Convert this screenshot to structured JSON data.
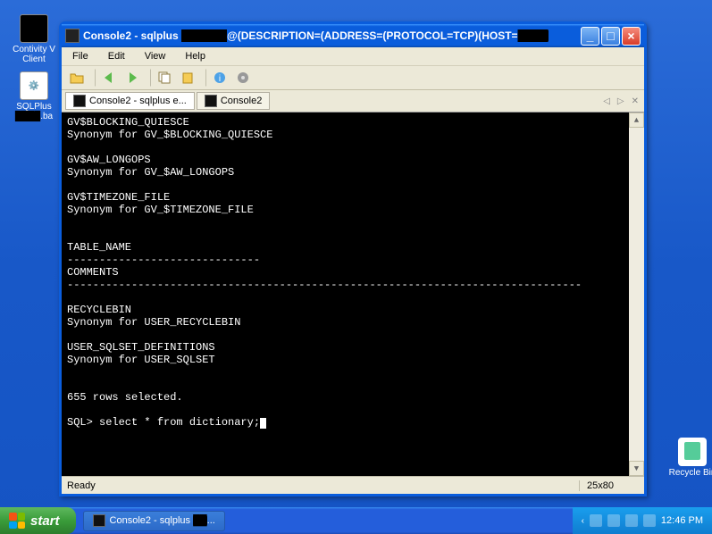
{
  "desktop": {
    "contivity": "Contivity V\nClient",
    "sqlplus": "SQLPlus",
    "sqlplus_ext": ".ba",
    "recycle": "Recycle Bin"
  },
  "window": {
    "title_prefix": "Console2 - sqlplus ",
    "title_mid": "@(DESCRIPTION=(ADDRESS=(PROTOCOL=TCP)(HOST=",
    "menu": [
      "File",
      "Edit",
      "View",
      "Help"
    ],
    "tabs": {
      "active": "Console2 - sqlplus e...",
      "inactive": "Console2"
    },
    "status": {
      "left": "Ready",
      "dims": "25x80"
    }
  },
  "terminal": {
    "lines": "GV$BLOCKING_QUIESCE\nSynonym for GV_$BLOCKING_QUIESCE\n\nGV$AW_LONGOPS\nSynonym for GV_$AW_LONGOPS\n\nGV$TIMEZONE_FILE\nSynonym for GV_$TIMEZONE_FILE\n\n\nTABLE_NAME\n------------------------------\nCOMMENTS\n--------------------------------------------------------------------------------\n\nRECYCLEBIN\nSynonym for USER_RECYCLEBIN\n\nUSER_SQLSET_DEFINITIONS\nSynonym for USER_SQLSET\n\n\n655 rows selected.\n",
    "prompt": "SQL> select * from dictionary;"
  },
  "taskbar": {
    "start": "start",
    "task": "Console2 - sqlplus ",
    "clock": "12:46 PM"
  }
}
